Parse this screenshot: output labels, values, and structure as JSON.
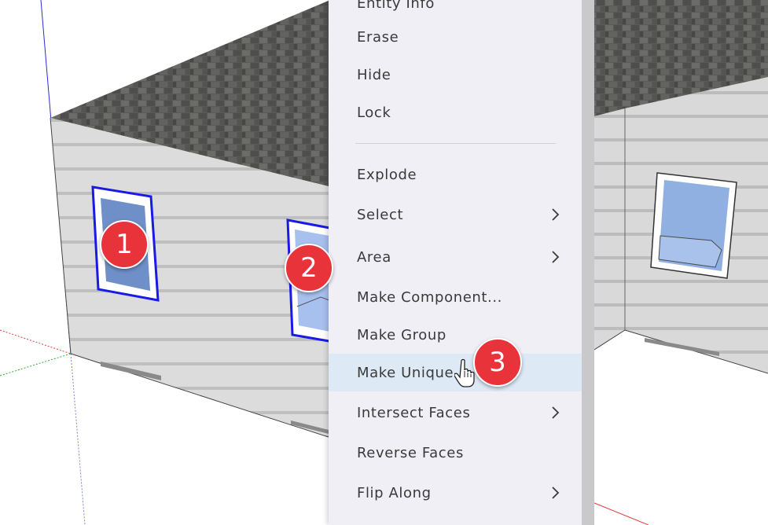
{
  "context_menu": {
    "items": [
      {
        "label": "Entity Info",
        "submenu": false,
        "highlighted": false
      },
      {
        "label": "Erase",
        "submenu": false,
        "highlighted": false
      },
      {
        "label": "Hide",
        "submenu": false,
        "highlighted": false
      },
      {
        "label": "Lock",
        "submenu": false,
        "highlighted": false
      },
      {
        "label": "Explode",
        "submenu": false,
        "highlighted": false
      },
      {
        "label": "Select",
        "submenu": true,
        "highlighted": false
      },
      {
        "label": "Area",
        "submenu": true,
        "highlighted": false
      },
      {
        "label": "Make Component...",
        "submenu": false,
        "highlighted": false
      },
      {
        "label": "Make Group",
        "submenu": false,
        "highlighted": false
      },
      {
        "label": "Make Unique",
        "submenu": false,
        "highlighted": true
      },
      {
        "label": "Intersect Faces",
        "submenu": true,
        "highlighted": false
      },
      {
        "label": "Reverse Faces",
        "submenu": false,
        "highlighted": false
      },
      {
        "label": "Flip Along",
        "submenu": true,
        "highlighted": false
      }
    ],
    "submenu_icon": "chevron-right-icon",
    "highlight_color": "#dde9f5"
  },
  "callouts": [
    "1",
    "2",
    "3"
  ],
  "callout_color": "#e8333b",
  "cursor_icon": "hand-pointer-icon"
}
